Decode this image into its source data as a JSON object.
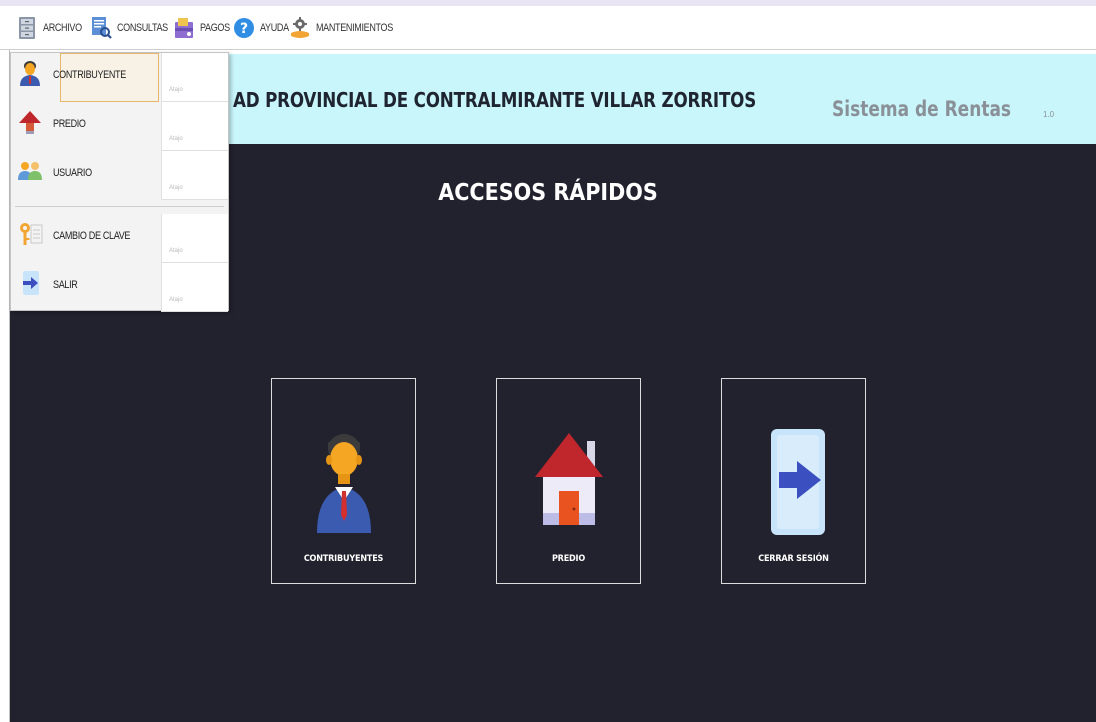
{
  "menubar": {
    "items": [
      {
        "label": "ARCHIVO",
        "icon": "archive-cabinet-icon"
      },
      {
        "label": "CONSULTAS",
        "icon": "document-search-icon"
      },
      {
        "label": "PAGOS",
        "icon": "payments-icon"
      },
      {
        "label": "AYUDA",
        "icon": "help-icon"
      },
      {
        "label": "MANTENIMIENTOS",
        "icon": "maintenance-gear-icon"
      }
    ]
  },
  "dropdown": {
    "items": [
      {
        "label": "CONTRIBUYENTE",
        "shortcut": "Atajo",
        "icon": "person-icon"
      },
      {
        "label": "PREDIO",
        "shortcut": "Atajo",
        "icon": "house-icon"
      },
      {
        "label": "USUARIO",
        "shortcut": "Atajo",
        "icon": "users-icon"
      },
      {
        "label": "CAMBIO DE CLAVE",
        "shortcut": "Atajo",
        "icon": "key-icon"
      },
      {
        "label": "SALIR",
        "shortcut": "Atajo",
        "icon": "exit-arrow-icon"
      }
    ]
  },
  "banner": {
    "title": "AD PROVINCIAL DE CONTRALMIRANTE VILLAR ZORRITOS",
    "system": "Sistema de Rentas",
    "version": "1.0"
  },
  "main": {
    "title": "ACCESOS RÁPIDOS",
    "tiles": [
      {
        "label": "CONTRIBUYENTES",
        "icon": "contributor-person-icon"
      },
      {
        "label": "PREDIO",
        "icon": "house-icon"
      },
      {
        "label": "CERRAR SESIÓN",
        "icon": "logout-door-icon"
      }
    ]
  },
  "colors": {
    "banner_bg": "#c9f6fb",
    "main_bg": "#22212e",
    "accent_red": "#d32f2f",
    "accent_blue": "#3f51b5"
  }
}
